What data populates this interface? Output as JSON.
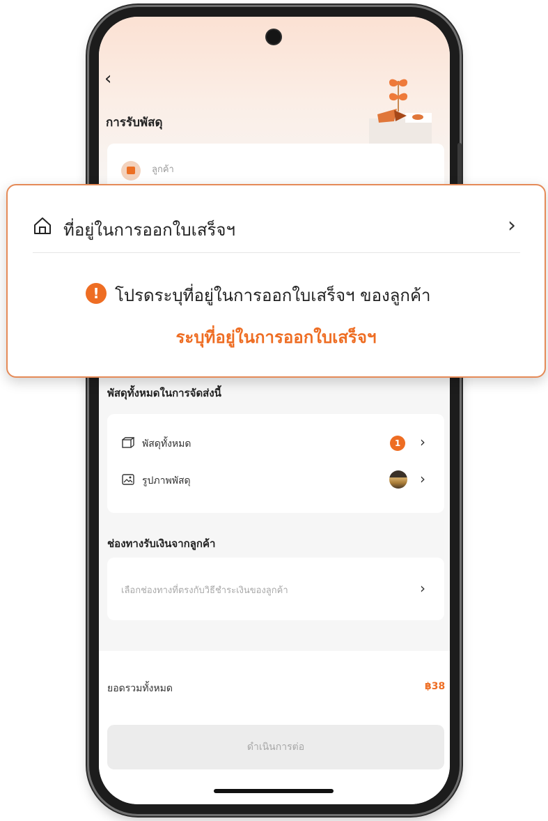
{
  "header": {
    "back_icon": "chevron-left-icon",
    "title": "การรับพัสดุ"
  },
  "customer": {
    "label": "ลูกค้า"
  },
  "callout": {
    "title": "ที่อยู่ในการออกใบเสร็จฯ",
    "warning": "โปรดระบุที่อยู่ในการออกใบเสร็จฯ ของลูกค้า",
    "action_link": "ระบุที่อยู่ในการออกใบเสร็จฯ"
  },
  "parcels": {
    "section_title": "พัสดุทั้งหมดในการจัดส่งนี้",
    "items": [
      {
        "label": "พัสดุทั้งหมด",
        "badge": "1"
      },
      {
        "label": "รูปภาพพัสดุ"
      }
    ]
  },
  "payment": {
    "section_title": "ช่องทางรับเงินจากลูกค้า",
    "placeholder": "เลือกช่องทางที่ตรงกับวิธีชำระเงินของลูกค้า"
  },
  "footer": {
    "total_label": "ยอดรวมทั้งหมด",
    "total_value": "฿38",
    "proceed_label": "ดำเนินการต่อ"
  },
  "colors": {
    "accent": "#ee6d23",
    "callout_border": "#e58a57"
  }
}
